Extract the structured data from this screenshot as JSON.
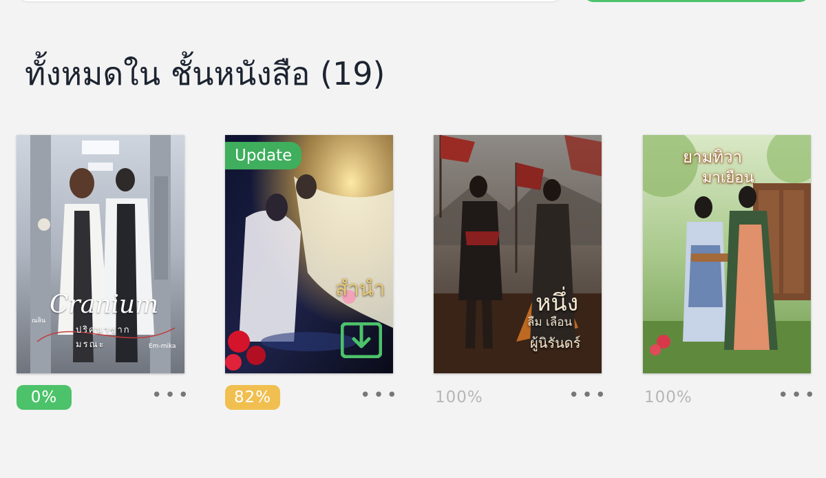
{
  "header": {
    "title": "ทั้งหมดใน ชั้นหนังสือ (19)"
  },
  "colors": {
    "green": "#4cc26a",
    "orange": "#f0bf50",
    "grey_text": "#b6b6b6"
  },
  "books": [
    {
      "cover_title": "Cranium",
      "cover_subtitle": "ปริศนาซาก มรณะ",
      "cover_author_left": "ณลิน",
      "cover_author_right": "Em-mika",
      "progress": "0%",
      "progress_style": "green",
      "menu_icon": "more-horizontal-icon"
    },
    {
      "badge": "Update",
      "cover_title": "สำนำ",
      "download_icon": "download-icon",
      "progress": "82%",
      "progress_style": "orange",
      "menu_icon": "more-horizontal-icon"
    },
    {
      "cover_title": "หนึ่ง",
      "cover_subtitle": "ลืม เลือน",
      "cover_title_2": "ผู้นิรันดร์",
      "progress": "100%",
      "progress_style": "plain",
      "menu_icon": "more-horizontal-icon"
    },
    {
      "cover_title": "ยามทิวา",
      "cover_title_2": "มาเยือน",
      "progress": "100%",
      "progress_style": "plain",
      "menu_icon": "more-horizontal-icon"
    }
  ],
  "more_label": "•••"
}
